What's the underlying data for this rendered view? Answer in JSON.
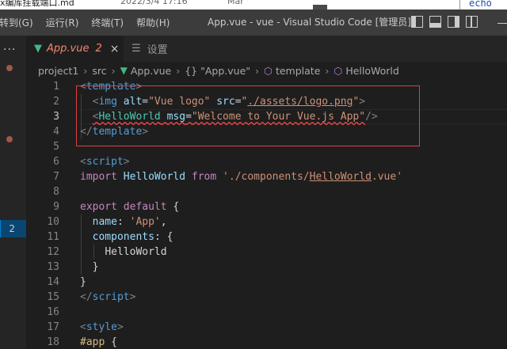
{
  "background_window": {
    "file_name": "x编库挂载端口.md",
    "date": "2022/3/4 17:16",
    "modified_label": "Mar",
    "terminal_text": "echo"
  },
  "titlebar": {
    "menu": [
      "转到(G)",
      "运行(R)",
      "终端(T)",
      "帮助(H)"
    ],
    "title": "App.vue - vue - Visual Studio Code [管理员]"
  },
  "sidebar": {
    "overflow": "...",
    "badge_problems": "2"
  },
  "tabs": [
    {
      "label": "App.vue",
      "problems": "2",
      "close": "×",
      "active": true
    },
    {
      "label": "设置",
      "icon": "settings-icon",
      "active": false
    }
  ],
  "breadcrumb": [
    "project1",
    "src",
    "App.vue",
    "{} \"App.vue\"",
    "template",
    "HelloWorld"
  ],
  "editor": {
    "current_line": 3,
    "line_numbers": [
      "1",
      "2",
      "3",
      "4",
      "5",
      "6",
      "7",
      "8",
      "9",
      "10",
      "11",
      "12",
      "13",
      "14",
      "15",
      "16",
      "17",
      "18"
    ],
    "lines": {
      "l1": {
        "open": "<",
        "tag": "template",
        "close": ">"
      },
      "l2": {
        "lt": "<",
        "tag": "img",
        "a1": "alt",
        "eq1": "=",
        "v1": "\"Vue logo\"",
        "a2": "src",
        "eq2": "=",
        "q1": "\"",
        "v2": "./assets/logo.png",
        "q2": "\"",
        "gt": ">"
      },
      "l3": {
        "lt": "<",
        "tag": "HelloWorld",
        "a1": "msg",
        "eq": "=",
        "v1": "\"Welcome to Your Vue.js App\"",
        "end": "/>"
      },
      "l4": {
        "lt": "</",
        "tag": "template",
        "gt": ">"
      },
      "l6": {
        "lt": "<",
        "tag": "script",
        "gt": ">"
      },
      "l7": {
        "kw1": "import",
        "id": "HelloWorld",
        "kw2": "from",
        "s1": "'./components/",
        "s2": "HelloWorld",
        "s3": ".vue'"
      },
      "l9": {
        "kw1": "export",
        "kw2": "default",
        "rest": "{"
      },
      "l10": {
        "prop": "name",
        "colon": ":",
        "str": "'App'",
        "comma": ","
      },
      "l11": {
        "prop": "components",
        "rest": ": {"
      },
      "l12": {
        "id": "HelloWorld"
      },
      "l13": {
        "rest": "}"
      },
      "l14": {
        "rest": "}"
      },
      "l15": {
        "lt": "</",
        "tag": "script",
        "gt": ">"
      },
      "l17": {
        "lt": "<",
        "tag": "style",
        "gt": ">"
      },
      "l18": {
        "sel": "#app",
        "rest": "{"
      }
    }
  },
  "colors": {
    "editor_bg": "#1e1e1e",
    "titlebar_bg": "#3c3c3c",
    "error_red": "#f48771",
    "vue_green": "#41b883"
  }
}
